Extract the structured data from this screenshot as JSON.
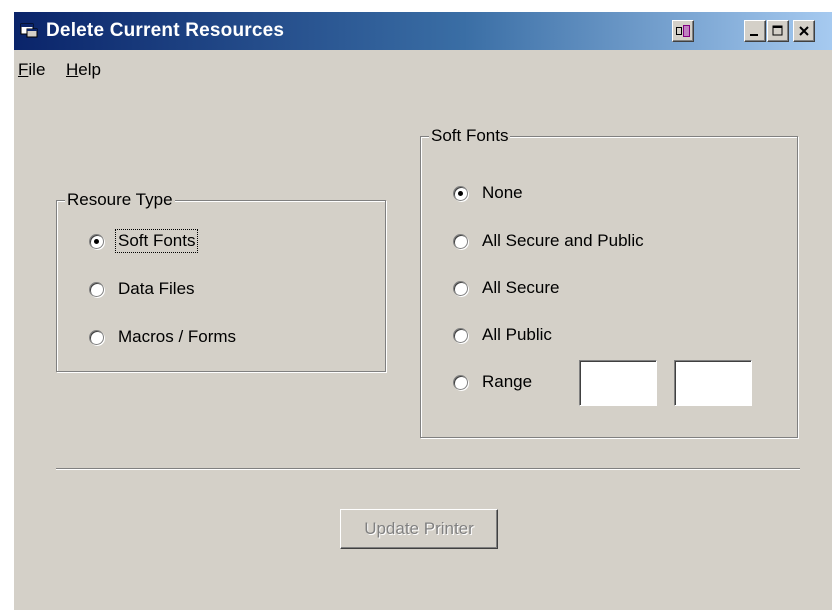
{
  "window": {
    "title": "Delete Current Resources",
    "icons": {
      "app": "app-window-icon",
      "extra": "cascade-icon",
      "minimize": "minimize-icon",
      "maximize": "maximize-icon",
      "close": "close-icon"
    }
  },
  "menu": {
    "items": [
      {
        "label": "File",
        "accel": "F",
        "rest": "ile"
      },
      {
        "label": "Help",
        "accel": "H",
        "rest": "elp"
      }
    ]
  },
  "resource_type": {
    "label": "Resoure Type",
    "options": [
      {
        "label": "Soft Fonts",
        "checked": true,
        "focused": true
      },
      {
        "label": "Data Files",
        "checked": false
      },
      {
        "label": "Macros / Forms",
        "checked": false
      }
    ]
  },
  "soft_fonts": {
    "label": "Soft Fonts",
    "options": [
      {
        "label": "None",
        "checked": true
      },
      {
        "label": "All Secure and Public",
        "checked": false
      },
      {
        "label": "All Secure",
        "checked": false
      },
      {
        "label": "All Public",
        "checked": false
      },
      {
        "label": "Range",
        "checked": false
      }
    ],
    "range_from": "",
    "range_to": ""
  },
  "actions": {
    "update_label": "Update Printer",
    "update_enabled": false
  }
}
